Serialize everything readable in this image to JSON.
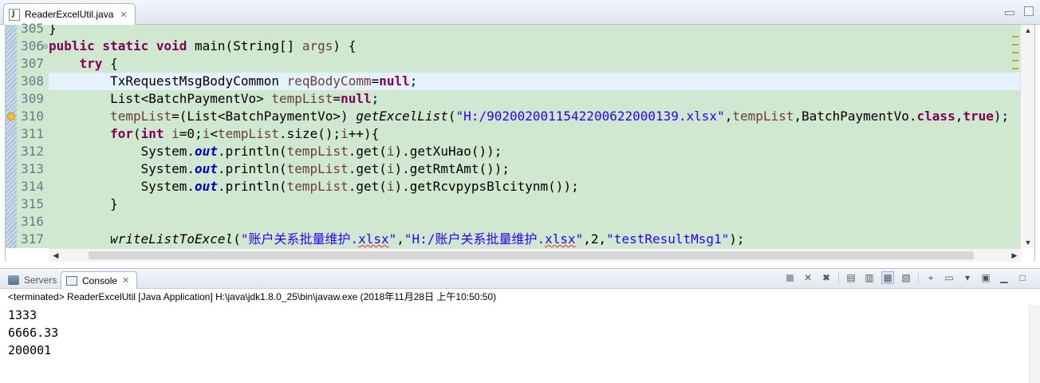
{
  "editor": {
    "tab_title": "ReaderExcelUtil.java",
    "close_glyph": "✕",
    "lines": [
      {
        "num": "305",
        "parts": [
          {
            "t": "}",
            "c": ""
          }
        ]
      },
      {
        "num": "306",
        "fold": "⊖",
        "parts": [
          {
            "t": "public static void",
            "c": "kw"
          },
          {
            "t": " main(String[] ",
            "c": ""
          },
          {
            "t": "args",
            "c": "var"
          },
          {
            "t": ") {",
            "c": ""
          }
        ]
      },
      {
        "num": "307",
        "parts": [
          {
            "t": "    ",
            "c": ""
          },
          {
            "t": "try",
            "c": "kw"
          },
          {
            "t": " {",
            "c": ""
          }
        ]
      },
      {
        "num": "308",
        "current": true,
        "parts": [
          {
            "t": "        TxRequestMsgBodyCommon ",
            "c": ""
          },
          {
            "t": "reqBodyComm",
            "c": "var"
          },
          {
            "t": "=",
            "c": ""
          },
          {
            "t": "null",
            "c": "kw"
          },
          {
            "t": ";",
            "c": ""
          }
        ]
      },
      {
        "num": "309",
        "parts": [
          {
            "t": "        List<BatchPaymentVo> ",
            "c": ""
          },
          {
            "t": "tempList",
            "c": "var"
          },
          {
            "t": "=",
            "c": ""
          },
          {
            "t": "null",
            "c": "kw"
          },
          {
            "t": ";",
            "c": ""
          }
        ]
      },
      {
        "num": "310",
        "warn": true,
        "parts": [
          {
            "t": "        ",
            "c": ""
          },
          {
            "t": "tempList",
            "c": "var"
          },
          {
            "t": "=(List<BatchPaymentVo>) ",
            "c": ""
          },
          {
            "t": "getExcelList",
            "c": "mth"
          },
          {
            "t": "(",
            "c": ""
          },
          {
            "t": "\"H:/90200200115422006220001З9.xlsx\"",
            "c": "str"
          },
          {
            "t": ",",
            "c": ""
          },
          {
            "t": "tempList",
            "c": "var"
          },
          {
            "t": ",BatchPaymentVo.",
            "c": ""
          },
          {
            "t": "class",
            "c": "kw"
          },
          {
            "t": ",",
            "c": ""
          },
          {
            "t": "true",
            "c": "kw"
          },
          {
            "t": ");",
            "c": ""
          }
        ]
      },
      {
        "num": "311",
        "parts": [
          {
            "t": "        ",
            "c": ""
          },
          {
            "t": "for",
            "c": "kw"
          },
          {
            "t": "(",
            "c": ""
          },
          {
            "t": "int",
            "c": "kw"
          },
          {
            "t": " ",
            "c": ""
          },
          {
            "t": "i",
            "c": "var"
          },
          {
            "t": "=0;",
            "c": ""
          },
          {
            "t": "i",
            "c": "var"
          },
          {
            "t": "<",
            "c": ""
          },
          {
            "t": "tempList",
            "c": "var"
          },
          {
            "t": ".size();",
            "c": ""
          },
          {
            "t": "i",
            "c": "var"
          },
          {
            "t": "++){",
            "c": ""
          }
        ]
      },
      {
        "num": "312",
        "parts": [
          {
            "t": "            System.",
            "c": ""
          },
          {
            "t": "out",
            "c": "fld"
          },
          {
            "t": ".println(",
            "c": ""
          },
          {
            "t": "tempList",
            "c": "var"
          },
          {
            "t": ".get(",
            "c": ""
          },
          {
            "t": "i",
            "c": "var"
          },
          {
            "t": ").getXuHao());",
            "c": ""
          }
        ]
      },
      {
        "num": "313",
        "parts": [
          {
            "t": "            System.",
            "c": ""
          },
          {
            "t": "out",
            "c": "fld"
          },
          {
            "t": ".println(",
            "c": ""
          },
          {
            "t": "tempList",
            "c": "var"
          },
          {
            "t": ".get(",
            "c": ""
          },
          {
            "t": "i",
            "c": "var"
          },
          {
            "t": ").getRmtAmt());",
            "c": ""
          }
        ]
      },
      {
        "num": "314",
        "parts": [
          {
            "t": "            System.",
            "c": ""
          },
          {
            "t": "out",
            "c": "fld"
          },
          {
            "t": ".println(",
            "c": ""
          },
          {
            "t": "tempList",
            "c": "var"
          },
          {
            "t": ".get(",
            "c": ""
          },
          {
            "t": "i",
            "c": "var"
          },
          {
            "t": ").getRcvpypsBlcitynm());",
            "c": ""
          }
        ]
      },
      {
        "num": "315",
        "parts": [
          {
            "t": "        }",
            "c": ""
          }
        ]
      },
      {
        "num": "316",
        "parts": [
          {
            "t": "",
            "c": ""
          }
        ]
      },
      {
        "num": "317",
        "parts": [
          {
            "t": "        ",
            "c": ""
          },
          {
            "t": "writeListToExcel",
            "c": "mth"
          },
          {
            "t": "(",
            "c": ""
          },
          {
            "t": "\"账户关系批量维护.",
            "c": "str"
          },
          {
            "t": "xlsx",
            "c": "str squig"
          },
          {
            "t": "\"",
            "c": "str"
          },
          {
            "t": ",",
            "c": ""
          },
          {
            "t": "\"H:/账户关系批量维护.",
            "c": "str"
          },
          {
            "t": "xlsx",
            "c": "str squig"
          },
          {
            "t": "\"",
            "c": "str"
          },
          {
            "t": ",2,",
            "c": ""
          },
          {
            "t": "\"testResultMsg1\"",
            "c": "str"
          },
          {
            "t": ");",
            "c": ""
          }
        ]
      }
    ]
  },
  "views": {
    "servers_label": "Servers",
    "console_label": "Console",
    "close_glyph": "✕"
  },
  "console": {
    "status": "<terminated> ReaderExcelUtil [Java Application] H:\\java\\jdk1.8.0_25\\bin\\javaw.exe (2018年11月28日 上午10:50:50)",
    "output": [
      "1333",
      "6666.33",
      "200001"
    ]
  },
  "colors": {
    "code_background": "#cfe8cf",
    "current_line": "#e6f2fb",
    "keyword": "#7f0055",
    "string": "#2a00ff",
    "field": "#0000c0"
  }
}
